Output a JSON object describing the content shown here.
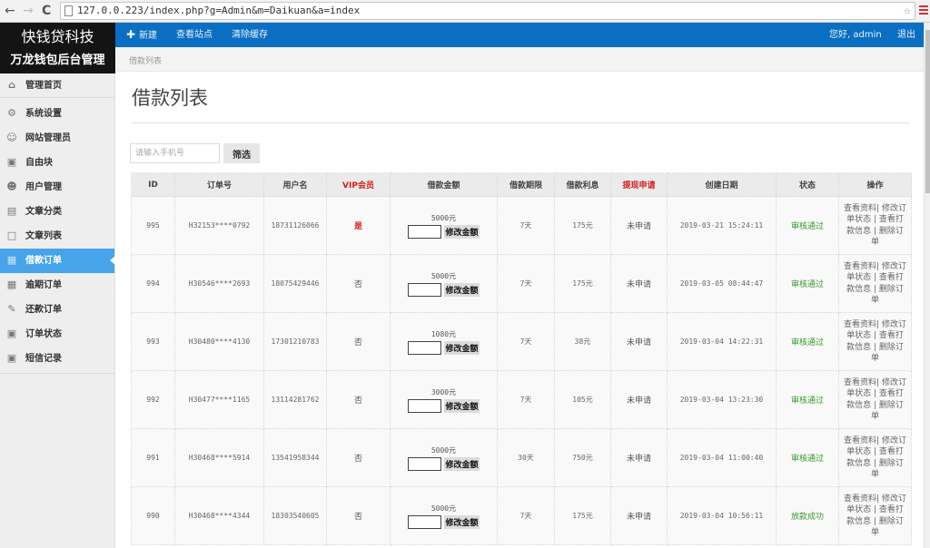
{
  "browser": {
    "url": "127.0.0.223/index.php?g=Admin&m=Daikuan&a=index"
  },
  "brand": {
    "company": "快钱贷科技",
    "app_name": "万龙钱包后台管理"
  },
  "topbar": {
    "new_label": "新建",
    "view_site_label": "查看站点",
    "clear_cache_label": "清除缓存",
    "greeting": "您好, admin",
    "logout_label": "退出"
  },
  "sidebar": {
    "items": [
      {
        "label": "管理首页",
        "icon": "home-icon",
        "active": false
      },
      {
        "label": "系统设置",
        "icon": "gear-icon",
        "active": false
      },
      {
        "label": "网站管理员",
        "icon": "user-icon",
        "active": false
      },
      {
        "label": "自由块",
        "icon": "block-icon",
        "active": false
      },
      {
        "label": "用户管理",
        "icon": "users-icon",
        "active": false
      },
      {
        "label": "文章分类",
        "icon": "book-icon",
        "active": false
      },
      {
        "label": "文章列表",
        "icon": "document-icon",
        "active": false
      },
      {
        "label": "借款订单",
        "icon": "grid-icon",
        "active": true
      },
      {
        "label": "逾期订单",
        "icon": "grid-icon",
        "active": false
      },
      {
        "label": "还款订单",
        "icon": "edit-icon",
        "active": false
      },
      {
        "label": "订单状态",
        "icon": "inbox-icon",
        "active": false
      },
      {
        "label": "短信记录",
        "icon": "inbox-icon",
        "active": false
      }
    ]
  },
  "main": {
    "breadcrumb": "借款列表",
    "title": "借款列表",
    "search": {
      "placeholder": "请输入手机号",
      "value": "",
      "button_label": "筛选"
    },
    "table": {
      "columns": [
        "ID",
        "订单号",
        "用户名",
        "VIP会员",
        "借款金额",
        "借款期限",
        "借款利息",
        "提现申请",
        "创建日期",
        "状态",
        "操作"
      ],
      "highlight_columns": [
        "VIP会员",
        "提现申请"
      ],
      "modify_amount_label": "修改金额",
      "actions": [
        "查看资料",
        "修改订单状态",
        "查看打款信息",
        "删除订单"
      ],
      "rows": [
        {
          "id": "995",
          "order_no": "H32153****0792",
          "username": "18731126066",
          "vip": "是",
          "amount": "5000元",
          "term": "7天",
          "interest": "175元",
          "withdraw": "未申请",
          "created": "2019-03-21 15:24:11",
          "status": "审核通过"
        },
        {
          "id": "994",
          "order_no": "H30546****2693",
          "username": "18075429446",
          "vip": "否",
          "amount": "5000元",
          "term": "7天",
          "interest": "175元",
          "withdraw": "未申请",
          "created": "2019-03-05 08:44:47",
          "status": "审核通过"
        },
        {
          "id": "993",
          "order_no": "H30480****4130",
          "username": "17301210783",
          "vip": "否",
          "amount": "1080元",
          "term": "7天",
          "interest": "38元",
          "withdraw": "未申请",
          "created": "2019-03-04 14:22:31",
          "status": "审核通过"
        },
        {
          "id": "992",
          "order_no": "H30477****1165",
          "username": "13114281762",
          "vip": "否",
          "amount": "3000元",
          "term": "7天",
          "interest": "105元",
          "withdraw": "未申请",
          "created": "2019-03-04 13:23:30",
          "status": "审核通过"
        },
        {
          "id": "991",
          "order_no": "H30468****5914",
          "username": "13541958344",
          "vip": "否",
          "amount": "5000元",
          "term": "30天",
          "interest": "750元",
          "withdraw": "未申请",
          "created": "2019-03-04 11:00:40",
          "status": "审核通过"
        },
        {
          "id": "990",
          "order_no": "H30468****4344",
          "username": "18303540605",
          "vip": "否",
          "amount": "5000元",
          "term": "7天",
          "interest": "175元",
          "withdraw": "未申请",
          "created": "2019-03-04 10:56:11",
          "status": "放款成功"
        }
      ]
    }
  },
  "colors": {
    "topbar_blue": "#0a6fc2",
    "sidebar_active": "#47a3ea",
    "logo_bg": "#141414",
    "highlight_red": "#d41d1d",
    "status_green": "#3b9a2e"
  }
}
